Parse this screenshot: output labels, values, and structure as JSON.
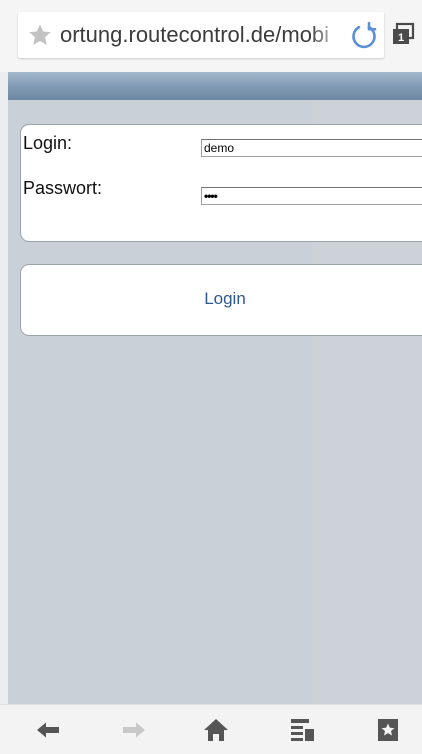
{
  "browser": {
    "url": "ortung.routecontrol.de/mobi",
    "icons": {
      "bookmark_star": "star-icon",
      "reload": "reload-icon",
      "tabs": "tabs-icon",
      "tab_count": "1"
    }
  },
  "login_form": {
    "login_label": "Login:",
    "login_value": "demo",
    "password_label": "Passwort:",
    "password_value": "demo"
  },
  "login_button": {
    "label": "Login"
  },
  "toolbar": {
    "icons": [
      "back-icon",
      "forward-icon",
      "home-icon",
      "reader-icon",
      "bookmark-icon"
    ]
  },
  "colors": {
    "page_background": "#c9d0d7",
    "header_gradient_top": "#a3b8cc",
    "header_gradient_bottom": "#6e88a3",
    "link_blue": "#2f5a8f",
    "reload_blue": "#5b8fd6"
  }
}
